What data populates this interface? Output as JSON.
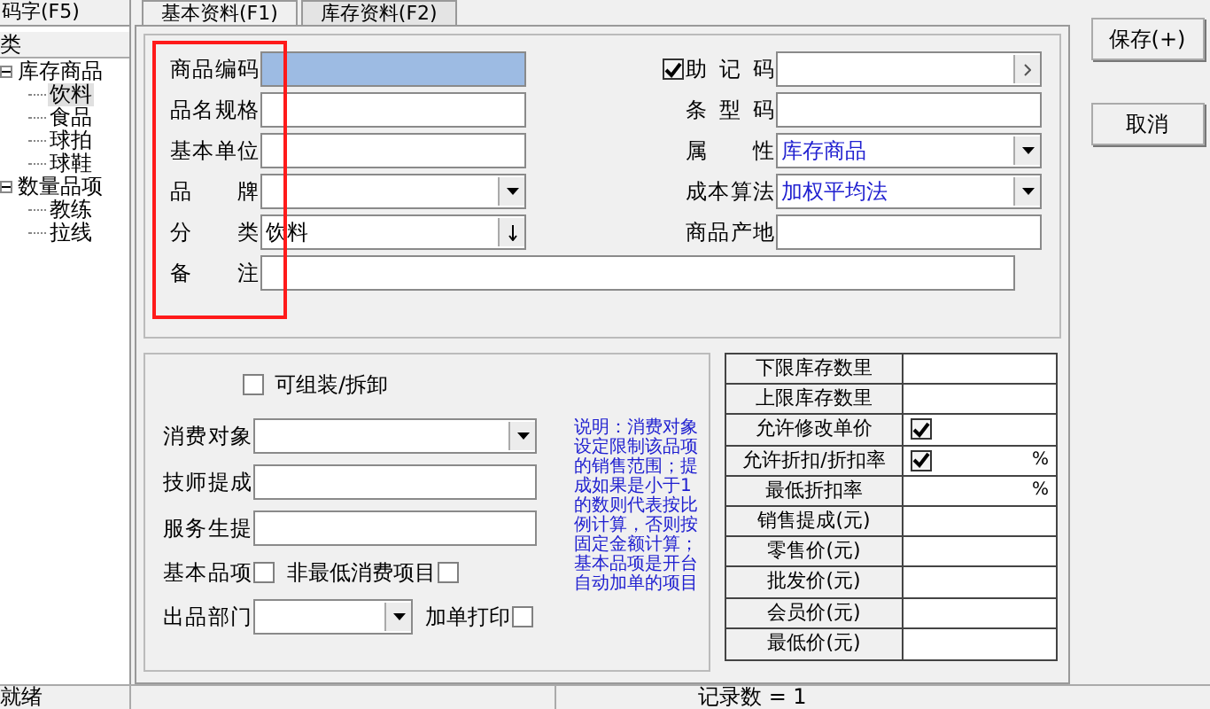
{
  "sidebar": {
    "search_value": "码字(F5)",
    "tree_header": "类",
    "tree": [
      {
        "label": "库存商品",
        "expanded": true,
        "selected": false,
        "children": [
          {
            "label": "饮料",
            "selected": true
          },
          {
            "label": "食品",
            "selected": false
          },
          {
            "label": "球拍",
            "selected": false
          },
          {
            "label": "球鞋",
            "selected": false
          }
        ]
      },
      {
        "label": "数量品项",
        "expanded": true,
        "selected": false,
        "children": [
          {
            "label": "教练",
            "selected": false
          },
          {
            "label": "拉线",
            "selected": false
          }
        ]
      }
    ]
  },
  "tabs": [
    {
      "label": "基本资料(F1)",
      "selected": true
    },
    {
      "label": "库存资料(F2)",
      "selected": false
    }
  ],
  "basic_form": {
    "left_fields": [
      {
        "label": "商品编码",
        "kind": "input",
        "focused": true
      },
      {
        "label": "品名规格",
        "kind": "input",
        "focused": false
      },
      {
        "label": "基本单位",
        "kind": "input",
        "focused": false
      },
      {
        "label": "品 牌",
        "kind": "dropdown",
        "focused": false
      },
      {
        "label": "分 类",
        "kind": "spin",
        "value": "饮料",
        "focused": false
      }
    ],
    "right_fields": [
      {
        "label": "助 记 码",
        "kind": "browse",
        "checked": true
      },
      {
        "label": "条 型 码",
        "kind": "input"
      },
      {
        "label": "属 性",
        "kind": "dropdown",
        "value": "库存商品"
      },
      {
        "label": "成本算法",
        "kind": "dropdown",
        "value": "加权平均法"
      },
      {
        "label": "商品产地",
        "kind": "input"
      }
    ],
    "remark": {
      "label": "备 注"
    },
    "highlighted": true
  },
  "consumption_form": {
    "assemble": {
      "label": "可组装/拆卸",
      "checked": false
    },
    "consumer": {
      "label": "消费对象"
    },
    "technician": {
      "label": "技师提成"
    },
    "waiter": {
      "label": "服务生提"
    },
    "basic_item": {
      "label": "基本品项",
      "checked": false
    },
    "non_min": {
      "label": "非最低消费项目",
      "checked": false
    },
    "department": {
      "label": "出品部门"
    },
    "extra_print": {
      "label": "加单打印",
      "checked": false
    },
    "note": "说明：消费对象设定限制该品项的销售范围；提成如果是小于1的数则代表按比例计算，否则按固定金额计算；基本品项是开台自动加单的项目"
  },
  "price_grid": [
    {
      "label": "下限库存数里",
      "kind": "text"
    },
    {
      "label": "上限库存数里",
      "kind": "text"
    },
    {
      "label": "允许修改单价",
      "kind": "checkbox",
      "checked": true
    },
    {
      "label": "允许折扣/折扣率",
      "kind": "checkbox",
      "checked": true,
      "unit": "%"
    },
    {
      "label": "最低折扣率",
      "kind": "text",
      "unit": "%"
    },
    {
      "label": "销售提成(元)",
      "kind": "text"
    },
    {
      "label": "零售价(元)",
      "kind": "text"
    },
    {
      "label": "批发价(元)",
      "kind": "text"
    },
    {
      "label": "会员价(元)",
      "kind": "text"
    },
    {
      "label": "最低价(元)",
      "kind": "text"
    }
  ],
  "buttons": [
    "保存(+)",
    "取消"
  ],
  "status_bar": {
    "state": "就绪",
    "records": "记录数 = 1"
  }
}
